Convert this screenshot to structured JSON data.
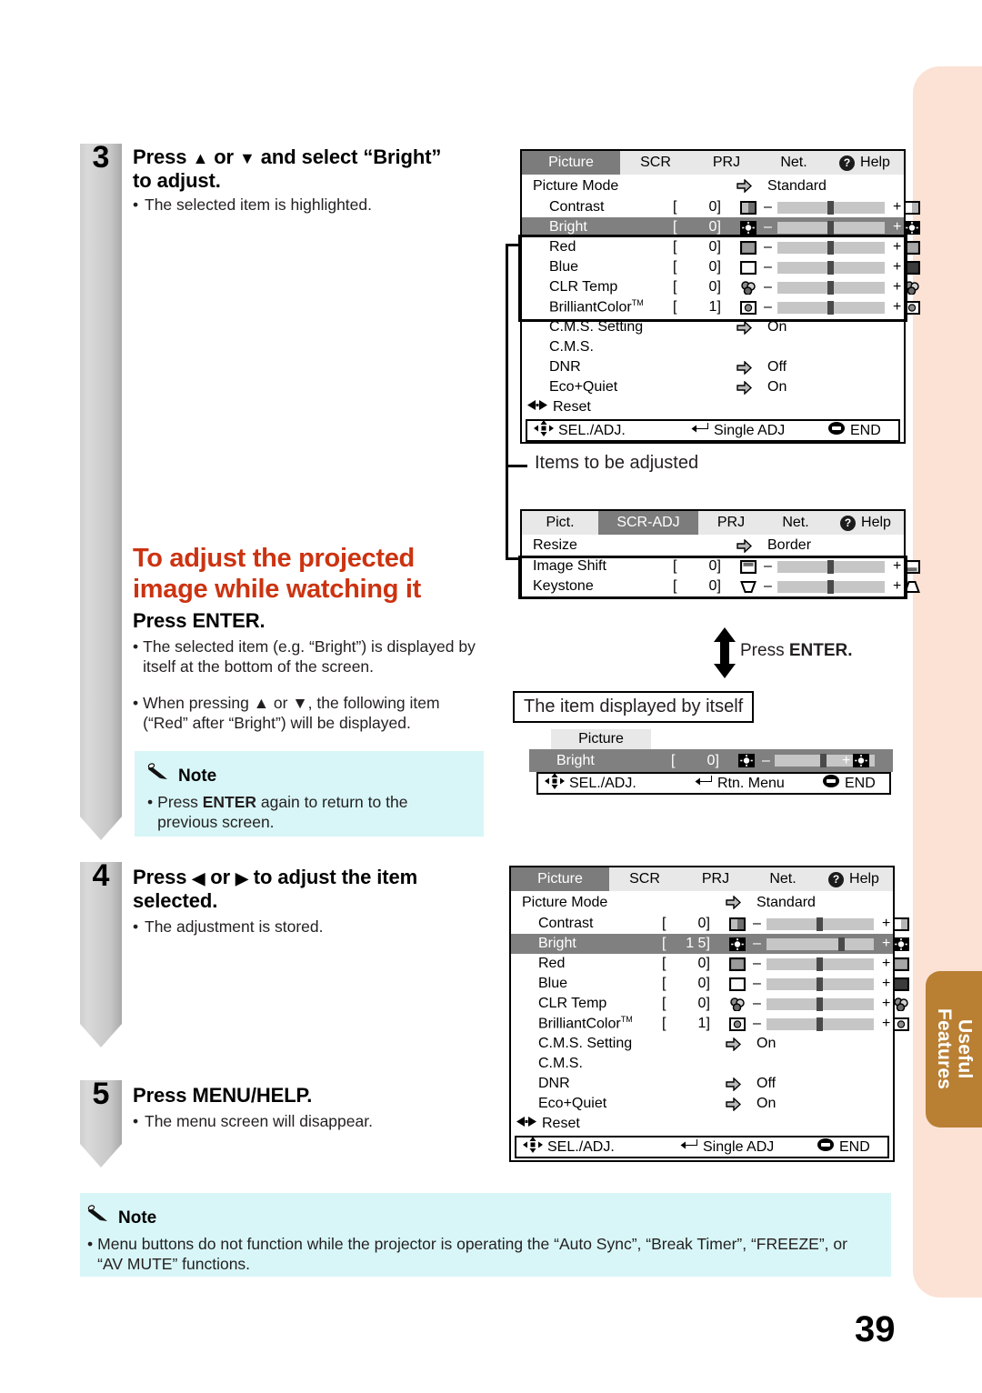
{
  "page": {
    "number": "39",
    "side_tab": "Useful\nFeatures"
  },
  "steps": [
    {
      "num": "3",
      "title": "Press ▲ or ▼ and select “Bright”\nto adjust.",
      "sub": "The selected item is highlighted."
    },
    {
      "num": "4",
      "title": "Press ◀ or ▶ to adjust the item\nselected.",
      "sub": "The adjustment is stored."
    },
    {
      "num": "5",
      "title": "Press MENU/HELP.",
      "sub": "The menu screen will disappear."
    }
  ],
  "section": {
    "heading": "To adjust the projected\nimage while watching it",
    "subheading_prefix": "Press ",
    "subheading_bold": "ENTER.",
    "bullets": [
      "The selected item (e.g. “Bright”) is displayed by itself at the bottom of the screen.",
      "When pressing ▲ or ▼, the following item (“Red” after “Bright”) will be displayed."
    ]
  },
  "note_small": {
    "label": "Note",
    "text_prefix": "Press ",
    "text_bold": "ENTER",
    "text_suffix": " again to return to the previous screen."
  },
  "note_bottom": {
    "label": "Note",
    "text": "Menu buttons do not function while the projector is operating the “Auto Sync”, “Break Timer”, “FREEZE”, or “AV MUTE” functions."
  },
  "captions": {
    "items_to_be_adjusted": "Items to be adjusted",
    "item_displayed_by_itself": "The item displayed by itself",
    "press_enter_prefix": "Press ",
    "press_enter_bold": "ENTER."
  },
  "osd_picture_top": {
    "tabs": [
      {
        "label": "Picture",
        "active": true
      },
      {
        "label": "SCR",
        "active": false
      },
      {
        "label": "PRJ",
        "active": false
      },
      {
        "label": "Net.",
        "active": false
      },
      {
        "label": "Help",
        "active": false,
        "icon": "question-circle-icon"
      }
    ],
    "mode_row": {
      "label": "Picture Mode",
      "arrow": "arrow-right-icon",
      "value": "Standard"
    },
    "sliders": [
      {
        "label": "Contrast",
        "value": "0",
        "icon": "contrast-icon",
        "minus": "–",
        "plus": "+",
        "knob_pct": 50,
        "selected": false
      },
      {
        "label": "Bright",
        "value": "0",
        "icon": "bright-icon",
        "minus": "–",
        "plus": "+",
        "knob_pct": 50,
        "selected": true
      },
      {
        "label": "Red",
        "value": "0",
        "icon": "red-icon",
        "minus": "–",
        "plus": "+",
        "knob_pct": 50,
        "selected": false
      },
      {
        "label": "Blue",
        "value": "0",
        "icon": "blue-icon",
        "minus": "–",
        "plus": "+",
        "knob_pct": 50,
        "selected": false
      },
      {
        "label": "CLR Temp",
        "value": "0",
        "icon": "clrtemp-icon",
        "minus": "–",
        "plus": "+",
        "knob_pct": 50,
        "selected": false
      },
      {
        "label": "BrilliantColor™",
        "value": "1",
        "icon": "brilliant-icon",
        "minus": "–",
        "plus": "+",
        "knob_pct": 50,
        "selected": false
      }
    ],
    "arrow_rows": [
      {
        "label": "C.M.S. Setting",
        "arrow": "arrow-right-icon",
        "value": "On"
      },
      {
        "label": "C.M.S.",
        "arrow": "",
        "value": ""
      },
      {
        "label": "DNR",
        "arrow": "arrow-right-icon",
        "value": "Off"
      },
      {
        "label": "Eco+Quiet",
        "arrow": "arrow-right-icon",
        "value": "On"
      }
    ],
    "reset": "Reset",
    "footer": {
      "sel": "SEL./ADJ.",
      "mid": "Single ADJ",
      "end": "END"
    }
  },
  "osd_scr": {
    "tabs": [
      {
        "label": "Pict.",
        "active": false
      },
      {
        "label": "SCR-ADJ",
        "active": true
      },
      {
        "label": "PRJ",
        "active": false
      },
      {
        "label": "Net.",
        "active": false
      },
      {
        "label": "Help",
        "active": false,
        "icon": "question-circle-icon"
      }
    ],
    "resize_row": {
      "label": "Resize",
      "arrow": "arrow-right-icon",
      "value": "Border"
    },
    "sliders": [
      {
        "label": "Image Shift",
        "value": "0",
        "icon": "image-shift-icon",
        "minus": "–",
        "plus": "+",
        "knob_pct": 50,
        "selected": false
      },
      {
        "label": "Keystone",
        "value": "0",
        "icon": "keystone-icon",
        "minus": "–",
        "plus": "+",
        "knob_pct": 50,
        "selected": false
      }
    ]
  },
  "osd_single": {
    "tab_label": "Picture",
    "row": {
      "label": "Bright",
      "value": "0",
      "icon": "bright-icon",
      "minus": "–",
      "plus": "+",
      "knob_pct": 50
    },
    "footer": {
      "sel": "SEL./ADJ.",
      "mid": "Rtn. Menu",
      "end": "END"
    }
  },
  "osd_picture_bottom": {
    "tabs": [
      {
        "label": "Picture",
        "active": true
      },
      {
        "label": "SCR",
        "active": false
      },
      {
        "label": "PRJ",
        "active": false
      },
      {
        "label": "Net.",
        "active": false
      },
      {
        "label": "Help",
        "active": false,
        "icon": "question-circle-icon"
      }
    ],
    "mode_row": {
      "label": "Picture Mode",
      "arrow": "arrow-right-icon",
      "value": "Standard"
    },
    "sliders": [
      {
        "label": "Contrast",
        "value": "0",
        "icon": "contrast-icon",
        "minus": "–",
        "plus": "+",
        "knob_pct": 50,
        "selected": false
      },
      {
        "label": "Bright",
        "value": "1 5",
        "icon": "bright-icon",
        "minus": "–",
        "plus": "+",
        "knob_pct": 70,
        "selected": true
      },
      {
        "label": "Red",
        "value": "0",
        "icon": "red-icon",
        "minus": "–",
        "plus": "+",
        "knob_pct": 50,
        "selected": false
      },
      {
        "label": "Blue",
        "value": "0",
        "icon": "blue-icon",
        "minus": "–",
        "plus": "+",
        "knob_pct": 50,
        "selected": false
      },
      {
        "label": "CLR Temp",
        "value": "0",
        "icon": "clrtemp-icon",
        "minus": "–",
        "plus": "+",
        "knob_pct": 50,
        "selected": false
      },
      {
        "label": "BrilliantColor™",
        "value": "1",
        "icon": "brilliant-icon",
        "minus": "–",
        "plus": "+",
        "knob_pct": 50,
        "selected": false
      }
    ],
    "arrow_rows": [
      {
        "label": "C.M.S. Setting",
        "arrow": "arrow-right-icon",
        "value": "On"
      },
      {
        "label": "C.M.S.",
        "arrow": "",
        "value": ""
      },
      {
        "label": "DNR",
        "arrow": "arrow-right-icon",
        "value": "Off"
      },
      {
        "label": "Eco+Quiet",
        "arrow": "arrow-right-icon",
        "value": "On"
      }
    ],
    "reset": "Reset",
    "footer": {
      "sel": "SEL./ADJ.",
      "mid": "Single ADJ",
      "end": "END"
    }
  },
  "colors": {
    "accent_red": "#cc3311",
    "note_bg": "#d8f6f7",
    "peach": "#fbe2d5",
    "tab_brown": "#b97f33",
    "osd_sel": "#808080",
    "osd_tabbar": "#e8e8e8"
  }
}
